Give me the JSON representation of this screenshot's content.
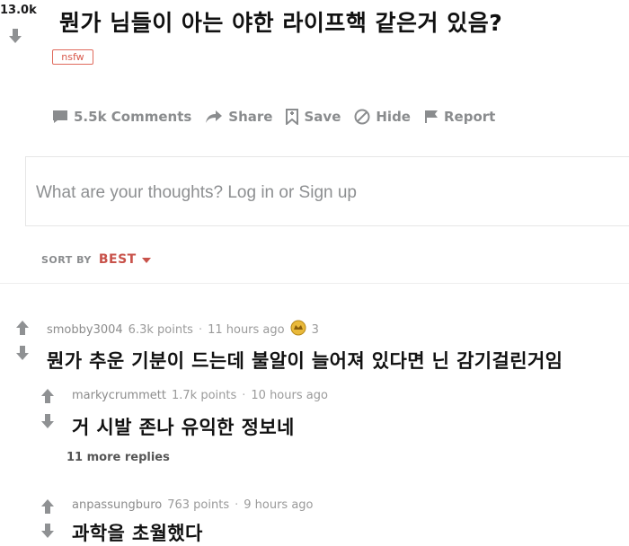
{
  "post": {
    "score": "13.0k",
    "title": "뭔가 님들이 아는 야한 라이프핵 같은거 있음?",
    "nsfw_tag": "nsfw"
  },
  "actions": {
    "comments": "5.5k Comments",
    "share": "Share",
    "save": "Save",
    "hide": "Hide",
    "report": "Report"
  },
  "comment_box": {
    "placeholder": "What are your thoughts? Log in or Sign up"
  },
  "sort": {
    "label": "SORT BY",
    "value": "BEST"
  },
  "comments": [
    {
      "author": "smobby3004",
      "points": "6.3k points",
      "time": "11 hours ago",
      "award_count": "3",
      "text": "뭔가 추운 기분이 드는데 불알이 늘어져 있다면 닌 감기걸린거임"
    },
    {
      "author": "markycrummett",
      "points": "1.7k points",
      "time": "10 hours ago",
      "text": "거 시발 존나 유익한 정보네",
      "more_replies": "11 more replies"
    },
    {
      "author": "anpassungburo",
      "points": "763 points",
      "time": "9 hours ago",
      "text": "과학을 초월했다"
    }
  ],
  "colors": {
    "nsfw": "#d85a4d",
    "sort_value": "#c8524a",
    "meta_gray": "#9a9a9a",
    "action_gray": "#8a8c8e"
  }
}
